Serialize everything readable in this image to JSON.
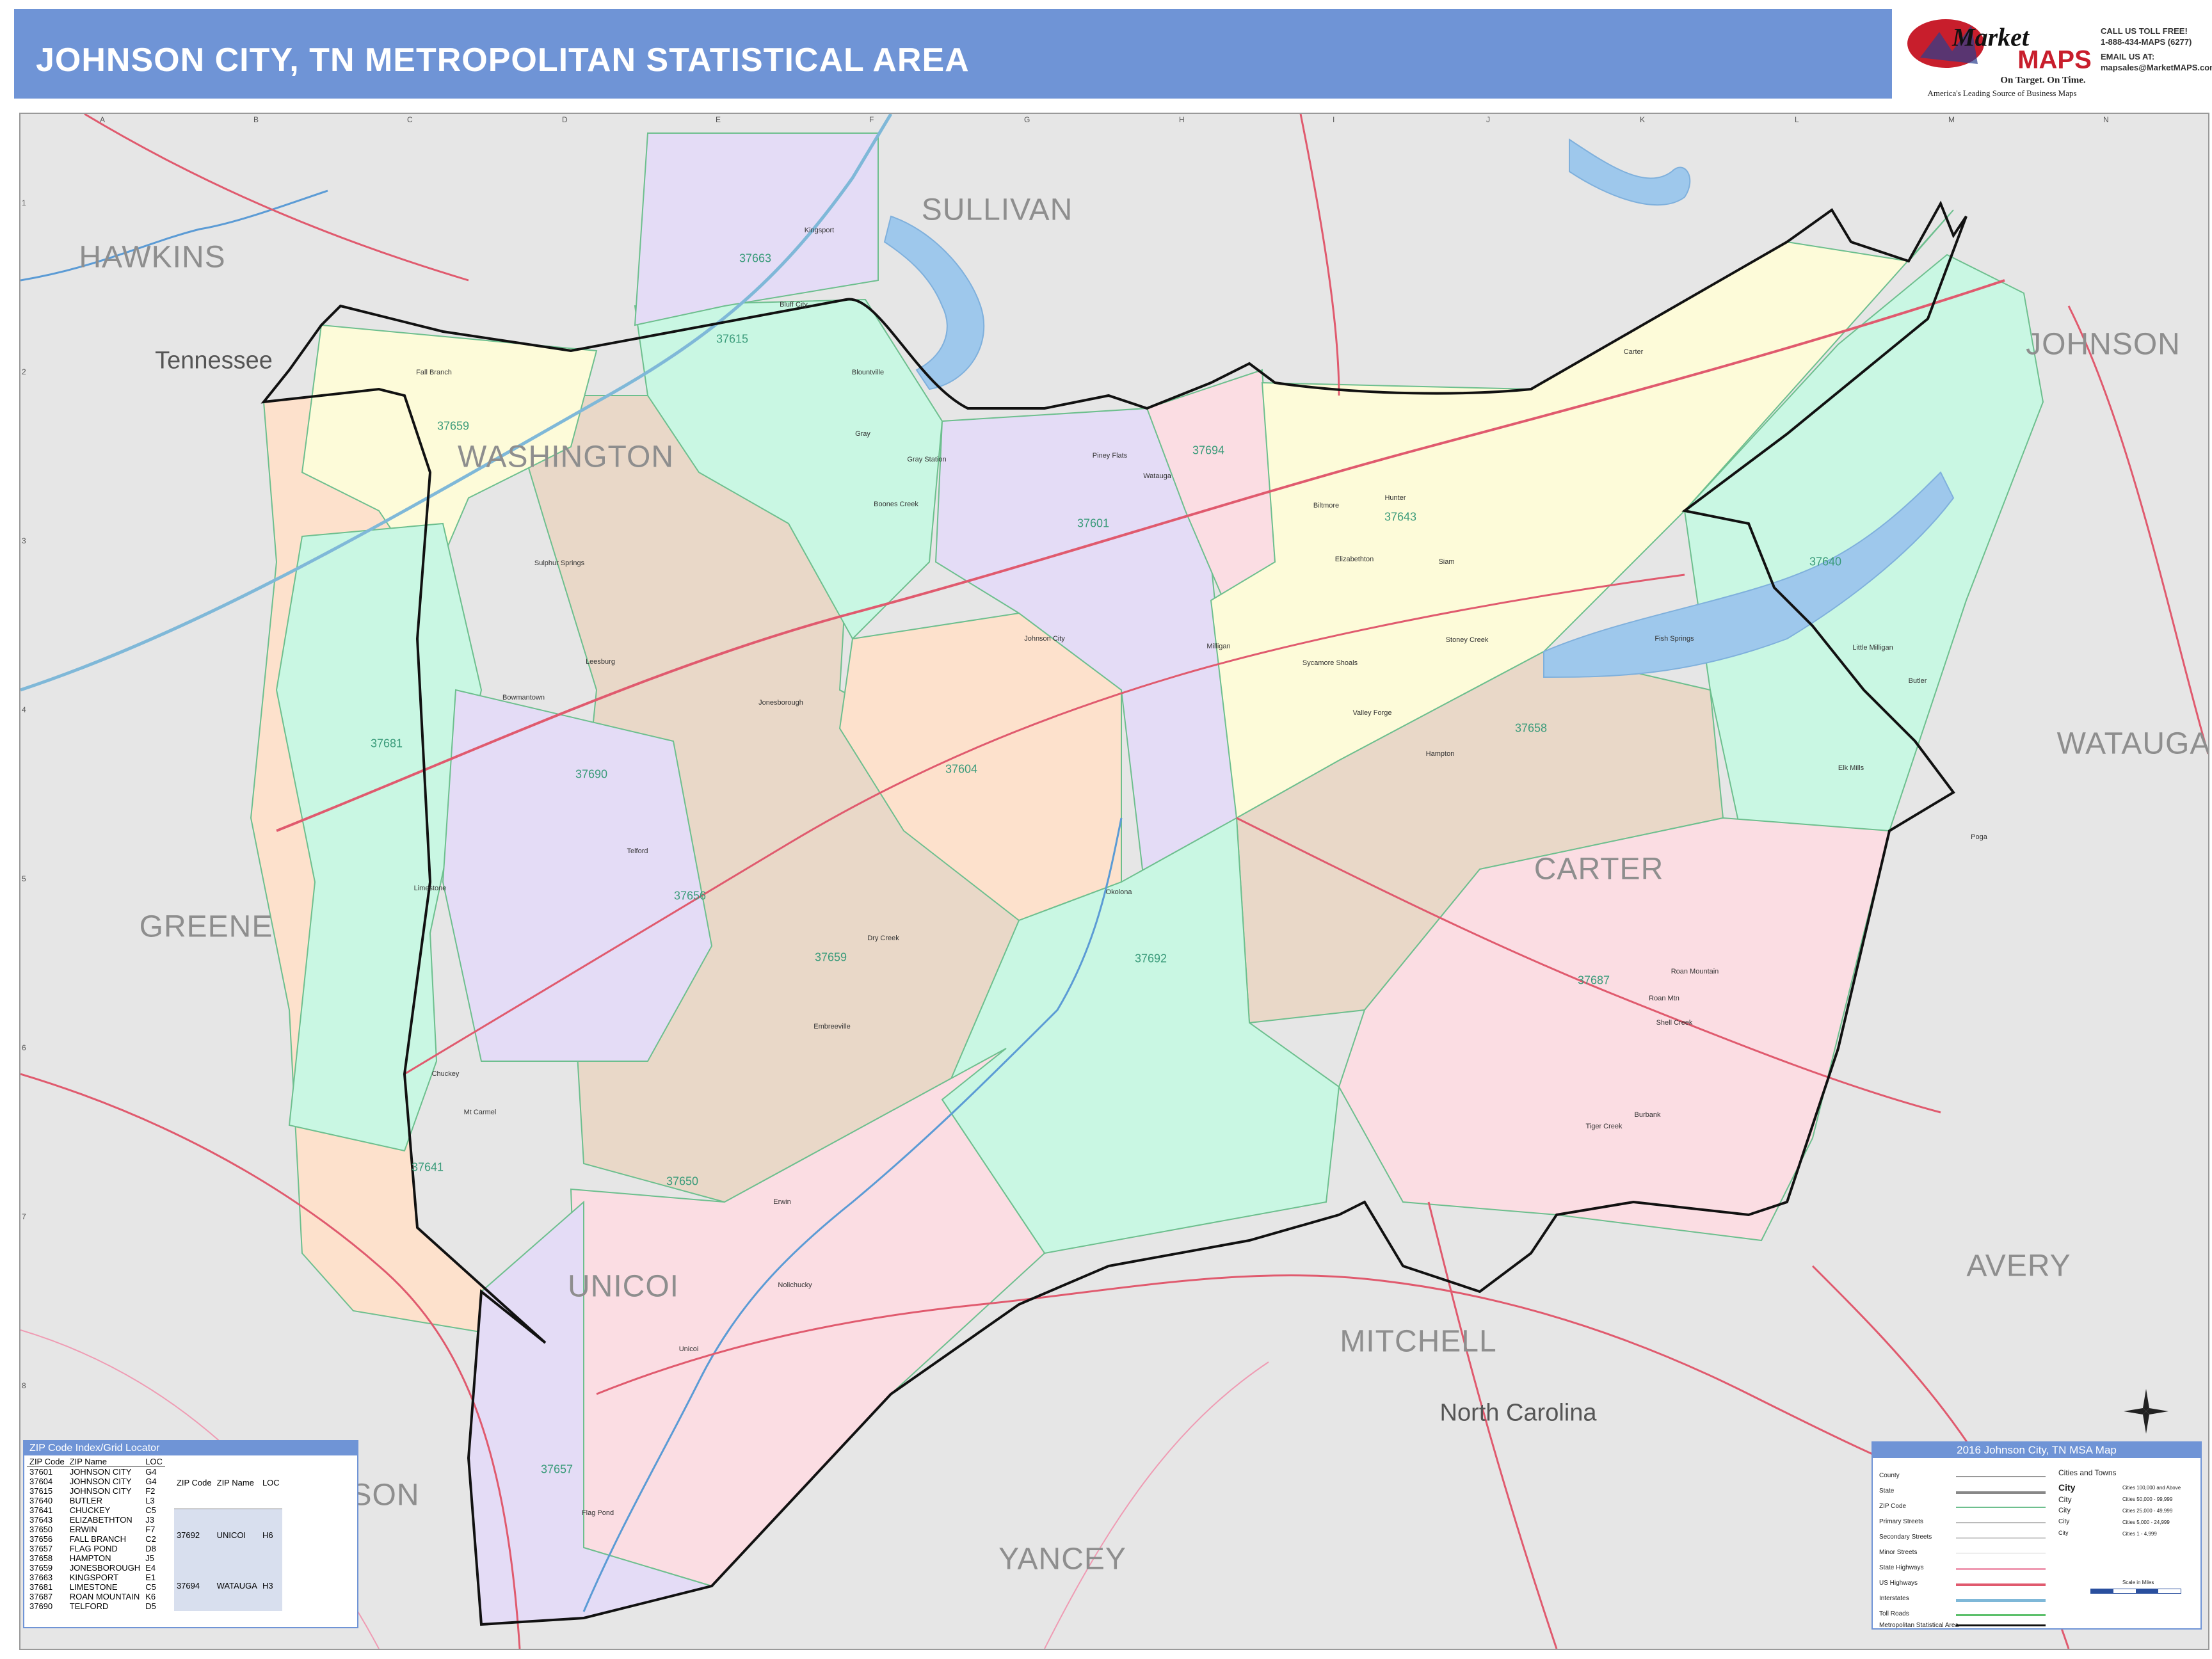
{
  "header": {
    "title": "JOHNSON CITY, TN METROPOLITAN STATISTICAL AREA"
  },
  "logo": {
    "brand_a": "Market",
    "brand_b": "MAPS",
    "tagline": "On Target.  On Time.",
    "slogan": "America's Leading Source of Business Maps"
  },
  "contact": {
    "line1": "CALL US TOLL FREE!",
    "line2": "1-888-434-MAPS (6277)",
    "line3": "EMAIL US AT:",
    "line4": "mapsales@MarketMAPS.com"
  },
  "grid": {
    "columns": [
      "A",
      "B",
      "C",
      "D",
      "E",
      "F",
      "G",
      "H",
      "I",
      "J",
      "K",
      "L",
      "M",
      "N"
    ],
    "rows": [
      "1",
      "2",
      "3",
      "4",
      "5",
      "6",
      "7",
      "8"
    ]
  },
  "counties": [
    {
      "name": "HAWKINS"
    },
    {
      "name": "SULLIVAN"
    },
    {
      "name": "JOHNSON"
    },
    {
      "name": "WASHINGTON"
    },
    {
      "name": "WATAUGA"
    },
    {
      "name": "CARTER"
    },
    {
      "name": "GREENE"
    },
    {
      "name": "UNICOI"
    },
    {
      "name": "AVERY"
    },
    {
      "name": "MITCHELL"
    },
    {
      "name": "YANCEY"
    },
    {
      "name": "SON"
    }
  ],
  "states": [
    {
      "name": "Tennessee"
    },
    {
      "name": "North Carolina"
    }
  ],
  "zips": [
    "37663",
    "37615",
    "37659",
    "37694",
    "37601",
    "37643",
    "37640",
    "37658",
    "37681",
    "37690",
    "37604",
    "37656",
    "37659",
    "37692",
    "37687",
    "37641",
    "37650",
    "37657"
  ],
  "cities": [
    "Bluff City",
    "Kingsport",
    "Blountville",
    "Gray",
    "Johnson City",
    "Elizabethton",
    "Jonesborough",
    "Telford",
    "Limestone",
    "Erwin",
    "Unicoi",
    "Hampton",
    "Roan Mountain",
    "Butler",
    "Fall Branch",
    "Chuckey",
    "Flag Pond",
    "Watauga",
    "Milligan",
    "Piney Flats",
    "Sycamore Shoals",
    "Boones Creek",
    "Gray Station",
    "Embreeville",
    "Sulphur Springs",
    "Leesburg",
    "Bowmantown",
    "Roan Mtn",
    "Dry Creek",
    "Okolona",
    "Valley Forge",
    "Hunter",
    "Biltmore",
    "Siam",
    "Stoney Creek",
    "Carter",
    "Little Milligan",
    "Elk Mills",
    "Poga",
    "Shell Creek",
    "Burbank",
    "Tiger Creek",
    "Fish Springs",
    "Mt Carmel",
    "Nolichucky"
  ],
  "index": {
    "title": "ZIP Code Index/Grid Locator",
    "headers": [
      "ZIP Code",
      "ZIP Name",
      "LOC"
    ],
    "rows_left": [
      [
        "37601",
        "JOHNSON CITY",
        "G4"
      ],
      [
        "37604",
        "JOHNSON CITY",
        "G4"
      ],
      [
        "37615",
        "JOHNSON CITY",
        "F2"
      ],
      [
        "37640",
        "BUTLER",
        "L3"
      ],
      [
        "37641",
        "CHUCKEY",
        "C5"
      ],
      [
        "37643",
        "ELIZABETHTON",
        "J3"
      ],
      [
        "37650",
        "ERWIN",
        "F7"
      ],
      [
        "37656",
        "FALL BRANCH",
        "C2"
      ],
      [
        "37657",
        "FLAG POND",
        "D8"
      ],
      [
        "37658",
        "HAMPTON",
        "J5"
      ],
      [
        "37659",
        "JONESBOROUGH",
        "E4"
      ],
      [
        "37663",
        "KINGSPORT",
        "E1"
      ],
      [
        "37681",
        "LIMESTONE",
        "C5"
      ],
      [
        "37687",
        "ROAN MOUNTAIN",
        "K6"
      ],
      [
        "37690",
        "TELFORD",
        "D5"
      ]
    ],
    "rows_right": [
      [
        "37692",
        "UNICOI",
        "H6"
      ],
      [
        "37694",
        "WATAUGA",
        "H3"
      ]
    ]
  },
  "legend": {
    "title": "2016 Johnson City, TN MSA Map",
    "items": [
      "County",
      "State",
      "ZIP Code",
      "Primary Streets",
      "Secondary Streets",
      "Minor Streets",
      "State Highways",
      "US Highways",
      "Interstates",
      "Toll Roads",
      "Metropolitan Statistical Area"
    ],
    "cities_title": "Cities and Towns",
    "city_sizes": [
      "Cities 100,000 and Above",
      "Cities 50,000 - 99,999",
      "Cities 25,000 - 49,999",
      "Cities 5,000 - 24,999",
      "Cities 1 - 4,999"
    ],
    "city_word": "City",
    "scale": "Scale in Miles"
  },
  "colors": {
    "header": "#6f94d6",
    "mint": "#c9f7e3",
    "lilac": "#e4dcf6",
    "pink": "#fbdde3",
    "peach": "#fde1cc",
    "tan": "#e9d8c8",
    "yellow": "#fdfbd9",
    "outside": "#e8e8e8",
    "water": "#9ec8ec",
    "road_red": "#e05a6e",
    "msa_line": "#111111"
  }
}
